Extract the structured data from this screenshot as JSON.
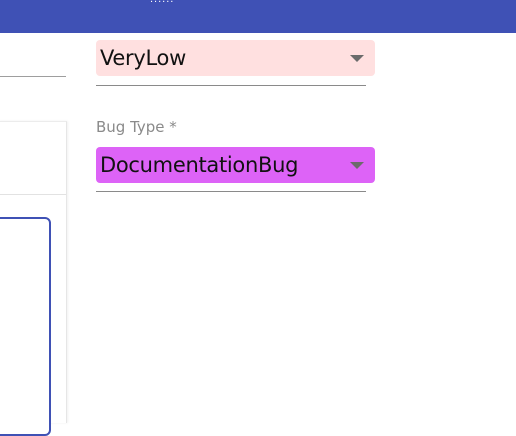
{
  "top_bar": {
    "color": "#3f51b5",
    "fragment_text": "......"
  },
  "priority_field": {
    "value": "VeryLow",
    "background": "#ffe0e0",
    "icon": "arrow-drop-down-icon"
  },
  "bug_type_field": {
    "label": "Bug Type *",
    "value": "DocumentationBug",
    "background": "#dd63f7",
    "icon": "arrow-drop-down-icon"
  },
  "left_editor": {
    "border_color": "#3f51b5"
  }
}
